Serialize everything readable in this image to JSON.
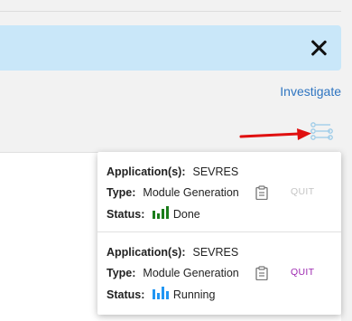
{
  "banner": {
    "close_icon": "close-icon"
  },
  "investigate_link": "Investigate",
  "tasks_icon": "tasks-list-icon",
  "tasks": [
    {
      "application_label": "Application(s):",
      "application_value": "SEVRES",
      "type_label": "Type:",
      "type_value": "Module Generation",
      "status_label": "Status:",
      "status_value": "Done",
      "status_color": "#1b7d1b",
      "quit_label": "QUIT",
      "quit_enabled": false
    },
    {
      "application_label": "Application(s):",
      "application_value": "SEVRES",
      "type_label": "Type:",
      "type_value": "Module Generation",
      "status_label": "Status:",
      "status_value": "Running",
      "status_color": "#2196f3",
      "quit_label": "QUIT",
      "quit_enabled": true,
      "quit_color": "#9c27b0"
    }
  ],
  "colors": {
    "banner": "#c9e7f9",
    "link": "#2f75c1",
    "arrow": "#e01010"
  }
}
